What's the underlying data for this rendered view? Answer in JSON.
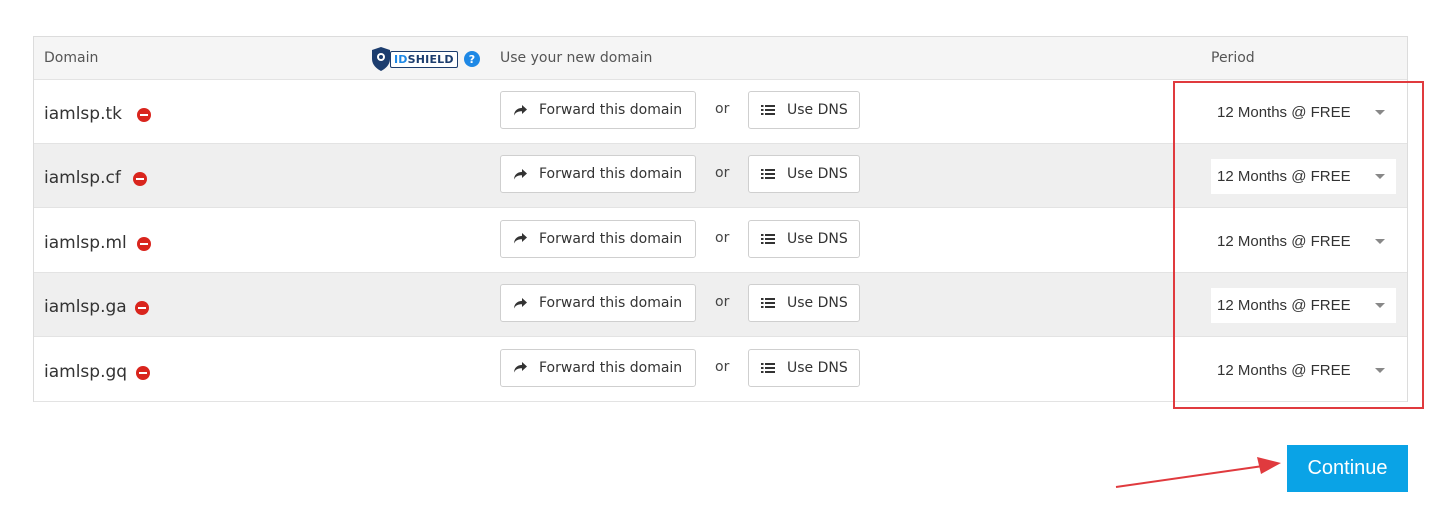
{
  "header": {
    "domain_label": "Domain",
    "idshield_prefix": "ID",
    "idshield_suffix": "SHIELD",
    "help_glyph": "?",
    "use_domain_label": "Use your new domain",
    "period_label": "Period"
  },
  "rows": [
    {
      "domain": "iamlsp.tk",
      "forward_label": "Forward this domain",
      "or_label": "or",
      "dns_label": "Use DNS",
      "period": "12 Months @ FREE"
    },
    {
      "domain": "iamlsp.cf",
      "forward_label": "Forward this domain",
      "or_label": "or",
      "dns_label": "Use DNS",
      "period": "12 Months @ FREE"
    },
    {
      "domain": "iamlsp.ml",
      "forward_label": "Forward this domain",
      "or_label": "or",
      "dns_label": "Use DNS",
      "period": "12 Months @ FREE"
    },
    {
      "domain": "iamlsp.ga",
      "forward_label": "Forward this domain",
      "or_label": "or",
      "dns_label": "Use DNS",
      "period": "12 Months @ FREE"
    },
    {
      "domain": "iamlsp.gq",
      "forward_label": "Forward this domain",
      "or_label": "or",
      "dns_label": "Use DNS",
      "period": "12 Months @ FREE"
    }
  ],
  "continue_label": "Continue",
  "icons": {
    "remove": "minus-circle-icon",
    "forward": "share-arrow-icon",
    "dns": "list-icon",
    "help": "question-circle-icon",
    "select": "caret-down-icon"
  },
  "colors": {
    "remove": "#d9251d",
    "continue_bg": "#0aa3e6",
    "annotation": "#e03a3e",
    "row_alt": "#efefef",
    "header_bg": "#f5f5f5"
  }
}
